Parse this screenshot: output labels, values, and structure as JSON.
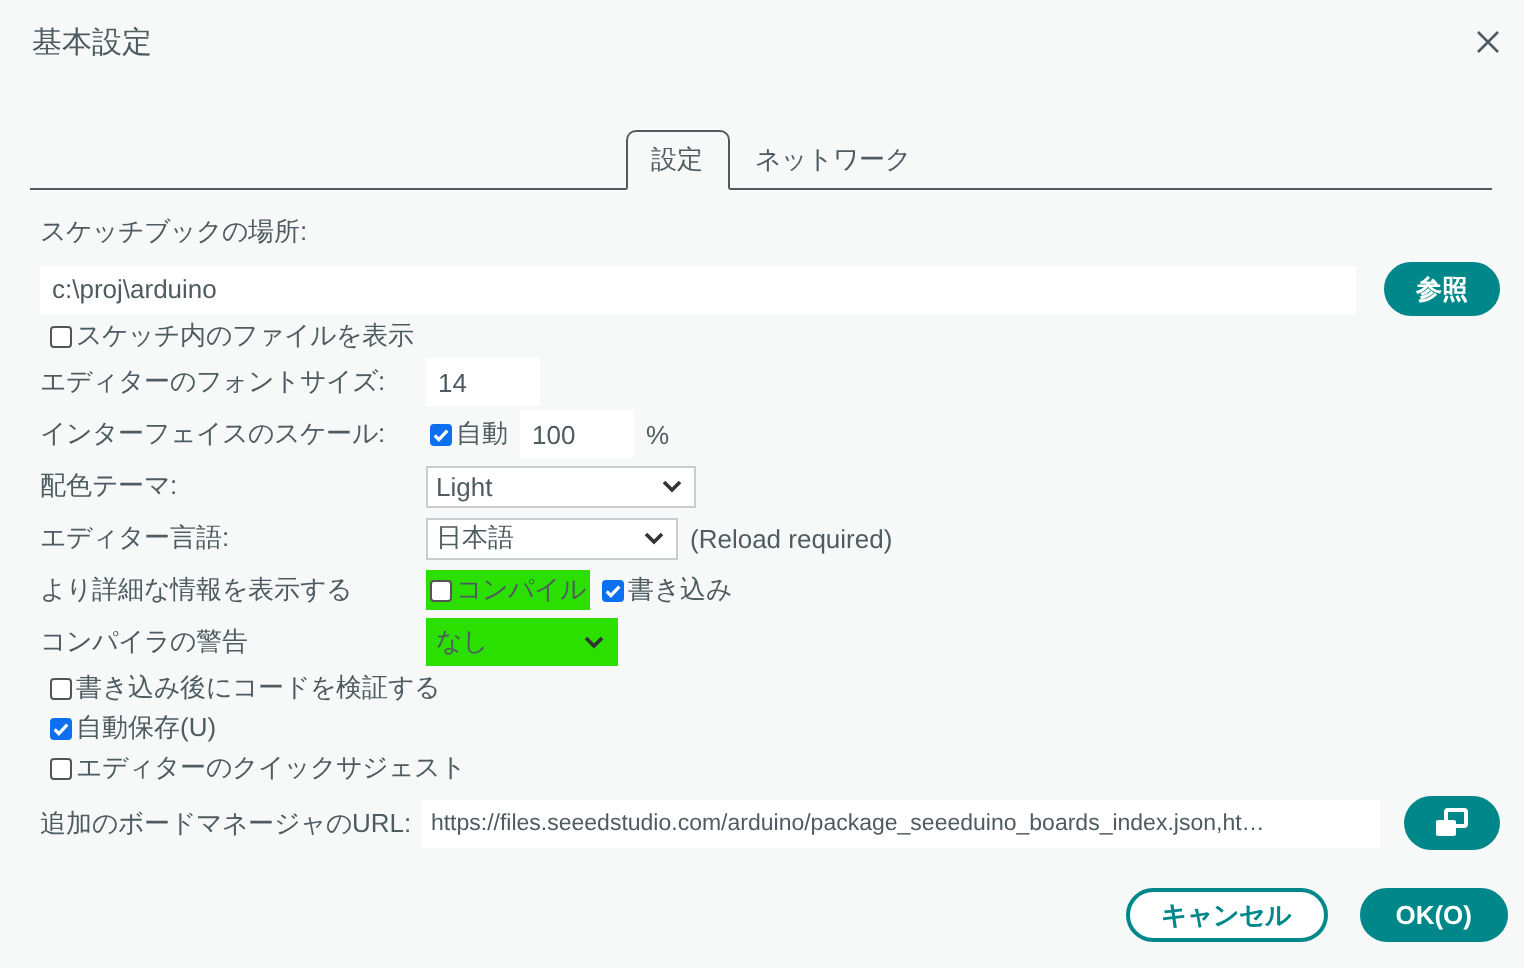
{
  "window": {
    "title": "基本設定"
  },
  "tabs": [
    {
      "label": "設定",
      "selected": true
    },
    {
      "label": "ネットワーク",
      "selected": false
    }
  ],
  "sketchbook": {
    "label": "スケッチブックの場所:",
    "value": "c:\\proj\\arduino",
    "browse_button": "参照"
  },
  "show_files": {
    "label": "スケッチ内のファイルを表示",
    "checked": false
  },
  "font_size": {
    "label": "エディターのフォントサイズ:",
    "value": "14"
  },
  "scale": {
    "label": "インターフェイスのスケール:",
    "auto_label": "自動",
    "auto_checked": true,
    "value": "100",
    "unit": "%"
  },
  "theme": {
    "label": "配色テーマ:",
    "value": "Light"
  },
  "language": {
    "label": "エディター言語:",
    "value": "日本語",
    "note": "(Reload required)"
  },
  "verbose": {
    "label": "より詳細な情報を表示する",
    "options": [
      {
        "label": "コンパイル",
        "checked": false,
        "highlighted": true
      },
      {
        "label": "書き込み",
        "checked": true
      }
    ]
  },
  "warnings": {
    "label": "コンパイラの警告",
    "value": "なし",
    "highlighted": true
  },
  "options": [
    {
      "label": "書き込み後にコードを検証する",
      "checked": false
    },
    {
      "label": "自動保存(U)",
      "checked": true
    },
    {
      "label": "エディターのクイックサジェスト",
      "checked": false
    }
  ],
  "board_urls": {
    "label": "追加のボードマネージャのURL:",
    "value": "https://files.seeedstudio.com/arduino/package_seeeduino_boards_index.json,ht…"
  },
  "buttons": [
    {
      "label": "キャンセル",
      "kind": "secondary"
    },
    {
      "label": "OK(O)",
      "kind": "primary"
    }
  ]
}
